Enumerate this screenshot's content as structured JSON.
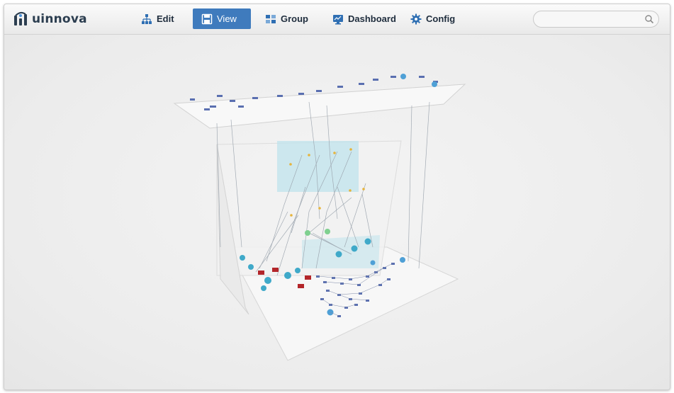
{
  "app": {
    "logo_text": "uinnova"
  },
  "toolbar": {
    "items": [
      {
        "label": "Edit",
        "icon": "sitemap-icon",
        "active": false
      },
      {
        "label": "View",
        "icon": "save-icon",
        "active": true
      },
      {
        "label": "Group",
        "icon": "group-icon",
        "active": false
      },
      {
        "label": "Dashboard",
        "icon": "monitor-icon",
        "active": false
      },
      {
        "label": "Config",
        "icon": "gear-icon",
        "active": false
      }
    ]
  },
  "search": {
    "placeholder": "",
    "value": "",
    "icon": "search-icon"
  },
  "colors": {
    "active_tab": "#3f7bbd",
    "panel": "#bfe3ec",
    "router": "#3fa9c9",
    "firewall": "#b3262a",
    "node": "#5a6fb0"
  }
}
